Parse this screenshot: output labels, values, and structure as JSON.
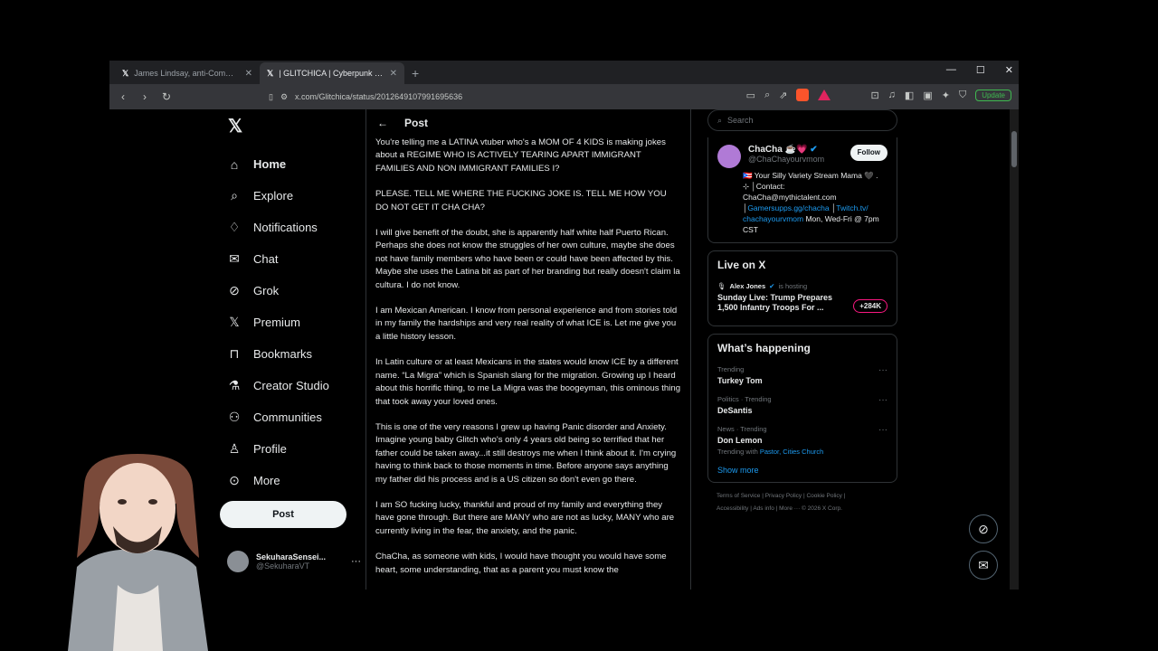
{
  "tabs": [
    {
      "title": "James Lindsay, anti-Communist on X",
      "active": false
    },
    {
      "title": "| GLITCHICA | Cyberpunk Vtuber",
      "active": true
    }
  ],
  "url": "x.com/Glitchica/status/2012649107991695636",
  "update_label": "Update",
  "nav": {
    "items": [
      "Home",
      "Explore",
      "Notifications",
      "Chat",
      "Grok",
      "Premium",
      "Bookmarks",
      "Creator Studio",
      "Communities",
      "Profile",
      "More"
    ],
    "post_label": "Post"
  },
  "me": {
    "name": "SekuharaSensei...",
    "handle": "@SekuharaVT"
  },
  "main": {
    "header": "Post",
    "paragraphs": [
      "You're telling me a LATINA vtuber who's a MOM OF 4 KIDS is making jokes about a REGIME WHO IS ACTIVELY TEARING APART IMMIGRANT FAMILIES AND NON IMMIGRANT FAMILIES I?",
      "PLEASE. TELL ME WHERE THE FUCKING JOKE IS. TELL ME HOW YOU DO NOT GET IT CHA CHA?",
      "I will give benefit of the doubt, she is apparently half white half Puerto Rican. Perhaps she does not know the struggles of her own culture, maybe she does not have family members who have been or could have been affected by this. Maybe she uses the Latina bit as part of her branding but really doesn't claim la cultura. I do not know.",
      "I am Mexican American. I know from personal experience and from stories told in my family the hardships and very real reality of what ICE is. Let me give you a little history lesson.",
      "In Latin culture or at least Mexicans in the states would know ICE by a different name. “La Migra” which is Spanish slang for the migration. Growing up I heard about this horrific thing, to me La Migra was the boogeyman, this ominous thing that took away your loved ones.",
      "This is one of the very reasons I grew up having Panic disorder and Anxiety. Imagine young baby Glitch who's only 4 years old being so terrified that her father could be taken away...it still destroys me when I think about it. I'm crying having to think back to those moments in time. Before anyone says anything my father did his process and is a US citizen so don't even go there.",
      "I am SO fucking lucky, thankful and proud of my family and everything they have gone through. But there are MANY who are not as lucky, MANY who are currently living in the fear, the anxiety, and the panic.",
      "ChaCha, as someone with kids, I would have thought you would have some heart, some understanding, that as a parent you must know the"
    ]
  },
  "right": {
    "search_placeholder": "Search",
    "profile": {
      "name": "ChaCha ☕💗",
      "handle": "@ChaChayourvmom",
      "follow": "Follow",
      "bio_1": "🇵🇷 Your Silly Variety Stream Mama 🖤 .",
      "bio_2": "⊹ │Contact:",
      "bio_3": "ChaCha@mythictalent.com",
      "bio_4": "│",
      "bio_link1": "Gamersupps.gg/chacha",
      "bio_5": "│",
      "bio_link2": "Twitch.tv/",
      "bio_link3": "chachayourvmom",
      "bio_6": " Mon, Wed-Fri @ 7pm CST"
    },
    "live": {
      "heading": "Live on X",
      "host": "Alex Jones",
      "hosting": "is hosting",
      "title": "Sunday Live: Trump Prepares 1,500 Infantry Troops For ...",
      "count": "+284K"
    },
    "happening": {
      "heading": "What’s happening",
      "trends": [
        {
          "meta": "Trending",
          "title": "Turkey Tom",
          "extra_label": "",
          "extra_links": ""
        },
        {
          "meta": "Politics · Trending",
          "title": "DeSantis",
          "extra_label": "",
          "extra_links": ""
        },
        {
          "meta": "News · Trending",
          "title": "Don Lemon",
          "extra_label": "Trending with",
          "extra_links": "Pastor, Cities Church"
        }
      ],
      "show_more": "Show more"
    },
    "footer_1": "Terms of Service  |  Privacy Policy  |  Cookie Policy  |",
    "footer_2": "Accessibility  |  Ads info  |  More ···  © 2026 X Corp."
  }
}
